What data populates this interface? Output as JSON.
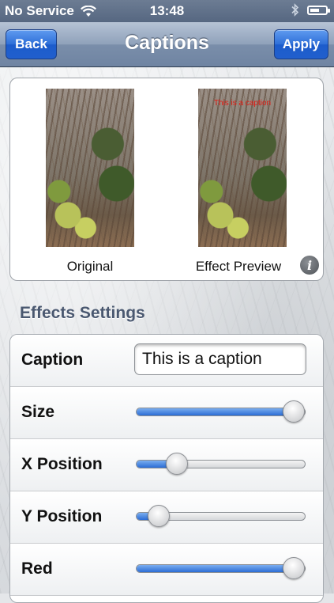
{
  "status_bar": {
    "carrier": "No Service",
    "time": "13:48",
    "battery_level": 0.6
  },
  "nav": {
    "back_label": "Back",
    "title": "Captions",
    "apply_label": "Apply"
  },
  "preview": {
    "original_label": "Original",
    "effect_label": "Effect Preview",
    "caption_overlay": "This is a caption",
    "caption_color": "#e01a12"
  },
  "section_title": "Effects Settings",
  "settings": {
    "caption": {
      "label": "Caption",
      "value": "This is a caption"
    },
    "sliders": [
      {
        "label": "Size",
        "value": 1.0
      },
      {
        "label": "X Position",
        "value": 0.24
      },
      {
        "label": "Y Position",
        "value": 0.13
      },
      {
        "label": "Red",
        "value": 1.0
      }
    ]
  },
  "colors": {
    "accent": "#2b6cd4",
    "nav_bar": "#8fa1ba",
    "section_text": "#4a5870"
  },
  "icons": [
    "wifi-icon",
    "bluetooth-icon",
    "battery-icon",
    "info-icon"
  ]
}
